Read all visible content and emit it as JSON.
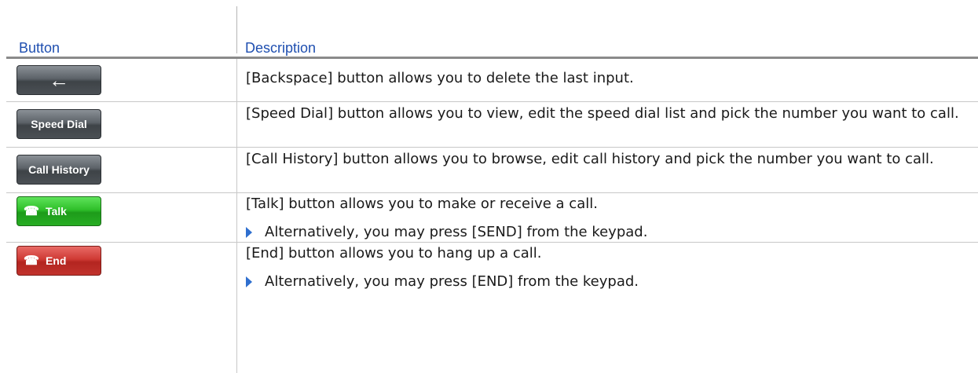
{
  "header": {
    "col1": "Button",
    "col2": "Description"
  },
  "rows": [
    {
      "button": {
        "label": "",
        "icon": "backspace-arrow-icon",
        "style": "gray"
      },
      "text": "[Backspace] button allows you to delete the last input.",
      "bullet": ""
    },
    {
      "button": {
        "label": "Speed Dial",
        "style": "gray"
      },
      "text": "[Speed Dial] button allows you to view, edit the speed dial list and pick the number you want to call.",
      "bullet": ""
    },
    {
      "button": {
        "label": "Call History",
        "style": "gray"
      },
      "text": "[Call History] button allows you to browse, edit call history and pick the number you want to call.",
      "bullet": ""
    },
    {
      "button": {
        "label": "Talk",
        "icon": "phone-icon",
        "style": "green"
      },
      "text": "[Talk] button allows you to make or receive a call.",
      "bullet": "Alternatively, you may press [SEND] from the keypad."
    },
    {
      "button": {
        "label": "End",
        "icon": "phone-icon",
        "style": "red"
      },
      "text": "[End] button allows you to hang up a call.",
      "bullet": "Alternatively, you may press [END] from the keypad."
    }
  ]
}
